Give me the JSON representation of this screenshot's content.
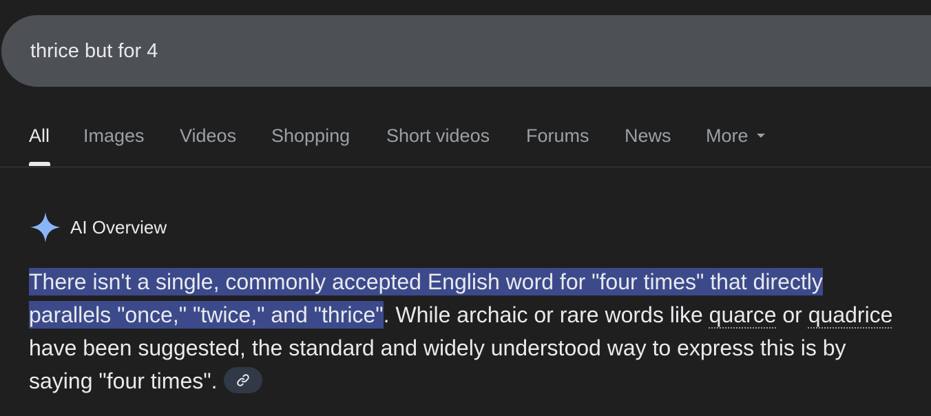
{
  "search": {
    "query": "thrice but for 4"
  },
  "tabs": [
    {
      "label": "All",
      "active": true
    },
    {
      "label": "Images"
    },
    {
      "label": "Videos"
    },
    {
      "label": "Shopping"
    },
    {
      "label": "Short videos"
    },
    {
      "label": "Forums"
    },
    {
      "label": "News"
    },
    {
      "label": "More"
    }
  ],
  "ai_overview": {
    "title": "AI Overview",
    "icon": "sparkle-icon",
    "highlighted_text": "There isn't a single, commonly accepted English word for \"four times\" that directly parallels \"once,\" \"twice,\" and \"thrice\"",
    "text_after_highlight": ". While archaic or rare words like ",
    "term1": "quarce",
    "between_terms": " or ",
    "term2": "quadrice",
    "text_end": " have been suggested, the standard and widely understood way to express this is by saying \"four times\".",
    "link_icon": "link-icon"
  },
  "colors": {
    "background": "#1f1f1f",
    "searchbar": "#4d5156",
    "highlight": "#3c4a8c",
    "sparkle": "#8ab4f8",
    "text": "#e8eaed",
    "muted": "#9aa0a6"
  }
}
